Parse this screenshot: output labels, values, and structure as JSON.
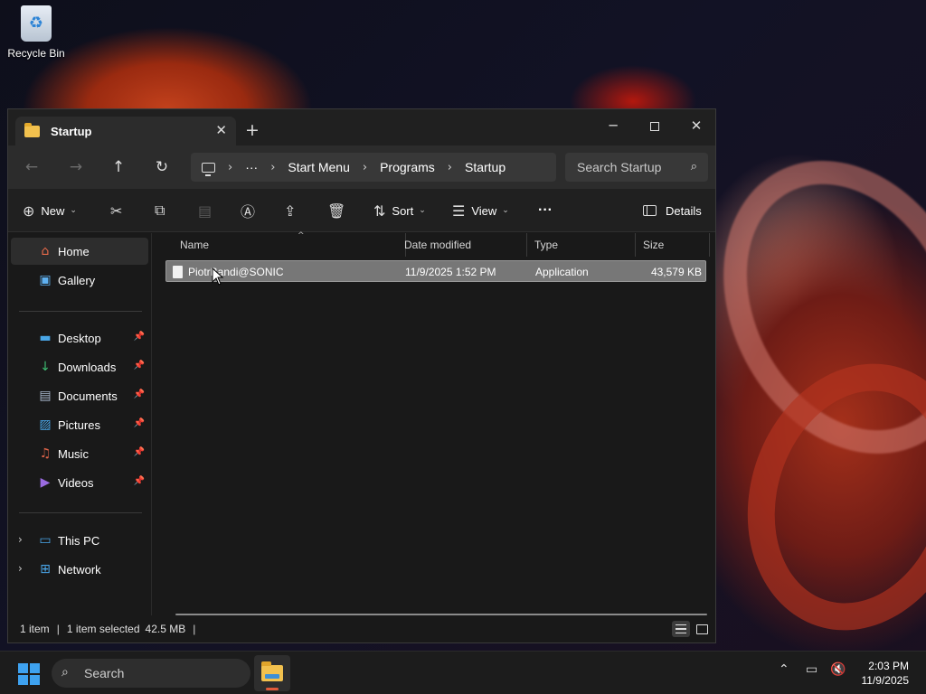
{
  "desktop": {
    "recycle_bin_label": "Recycle Bin"
  },
  "window": {
    "tab_title": "Startup",
    "tab_close": "✕",
    "new_tab": "+",
    "minimize": "─",
    "close": "✕"
  },
  "navigation": {
    "back": "←",
    "forward": "→",
    "up": "↑",
    "refresh": "↻",
    "breadcrumb_more": "···",
    "breadcrumb": [
      "Start Menu",
      "Programs",
      "Startup"
    ],
    "search_placeholder": "Search Startup"
  },
  "toolbar": {
    "new_label": "New",
    "sort_label": "Sort",
    "view_label": "View",
    "more": "···",
    "details_label": "Details"
  },
  "sidebar": {
    "items": [
      {
        "label": "Home",
        "icon": "home-icon"
      },
      {
        "label": "Gallery",
        "icon": "gallery-icon"
      },
      {
        "label": "Desktop",
        "icon": "desktop-icon",
        "pinned": true
      },
      {
        "label": "Downloads",
        "icon": "downloads-icon",
        "pinned": true
      },
      {
        "label": "Documents",
        "icon": "documents-icon",
        "pinned": true
      },
      {
        "label": "Pictures",
        "icon": "pictures-icon",
        "pinned": true
      },
      {
        "label": "Music",
        "icon": "music-icon",
        "pinned": true
      },
      {
        "label": "Videos",
        "icon": "videos-icon",
        "pinned": true
      },
      {
        "label": "This PC",
        "icon": "this-pc-icon",
        "expandable": true
      },
      {
        "label": "Network",
        "icon": "network-icon",
        "expandable": true
      }
    ]
  },
  "file_list": {
    "columns": [
      "Name",
      "Date modified",
      "Type",
      "Size"
    ],
    "rows": [
      {
        "name": "PiotrBandi@SONIC",
        "date_modified": "11/9/2025 1:52 PM",
        "type": "Application",
        "size": "43,579 KB",
        "selected": true
      }
    ]
  },
  "status": {
    "count": "1 item",
    "selection": "1 item selected",
    "size": "42.5 MB"
  },
  "taskbar": {
    "search_label": "Search",
    "time": "2:03 PM",
    "date": "11/9/2025"
  },
  "colors": {
    "accent": "#3ea2f0",
    "folder": "#f2c14e",
    "selection": "#777777"
  }
}
